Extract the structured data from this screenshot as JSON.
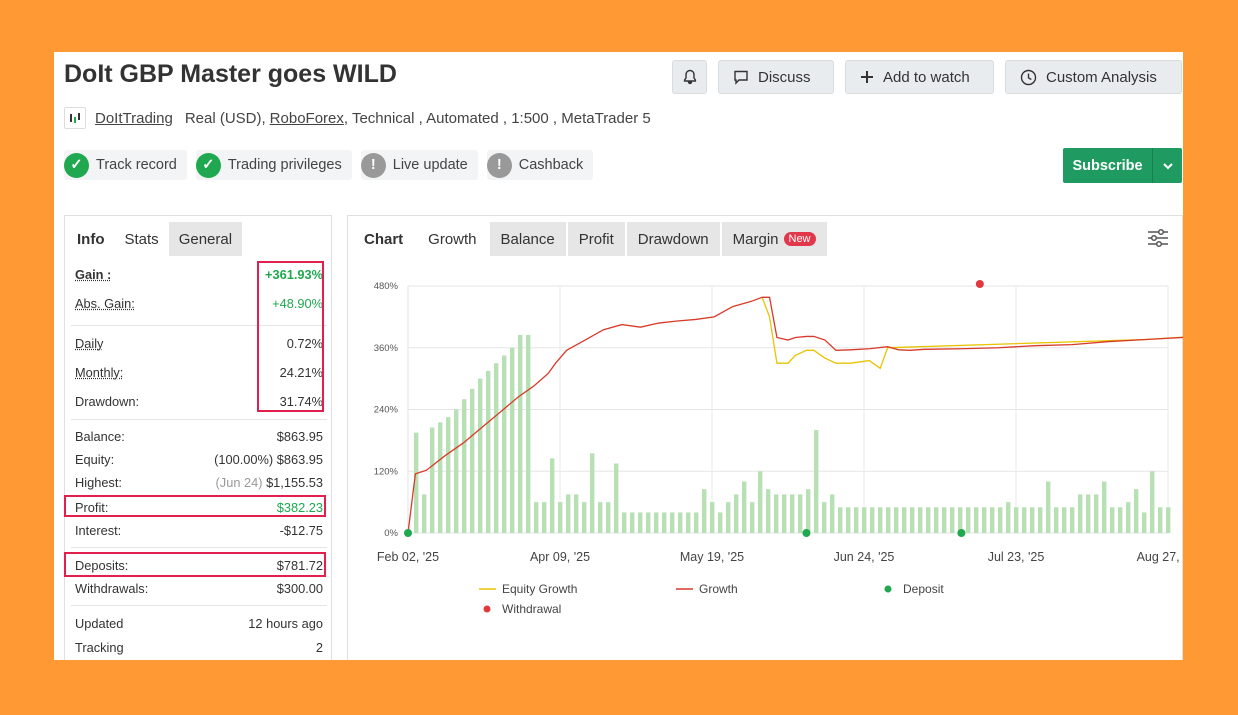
{
  "title": "DoIt GBP Master goes WILD",
  "top_buttons": {
    "discuss": "Discuss",
    "watch": "Add to watch",
    "custom": "Custom Analysis"
  },
  "meta": {
    "author": "DoItTrading",
    "account": "Real (USD),",
    "broker": "RoboForex",
    "rest": ", Technical , Automated , 1:500 , MetaTrader 5"
  },
  "badges": [
    {
      "label": "Track record",
      "status": "ok"
    },
    {
      "label": "Trading privileges",
      "status": "ok"
    },
    {
      "label": "Live update",
      "status": "no"
    },
    {
      "label": "Cashback",
      "status": "no"
    }
  ],
  "subscribe": "Subscribe",
  "left_tabs": {
    "info": "Info",
    "stats": "Stats",
    "general": "General"
  },
  "stats": {
    "gain": {
      "k": "Gain :",
      "v": "+361.93%"
    },
    "abs_gain": {
      "k": "Abs. Gain:",
      "v": "+48.90%"
    },
    "daily": {
      "k": "Daily",
      "v": "0.72%"
    },
    "monthly": {
      "k": "Monthly:",
      "v": "24.21%"
    },
    "drawdown": {
      "k": "Drawdown:",
      "v": "31.74%"
    },
    "balance": {
      "k": "Balance:",
      "v": "$863.95"
    },
    "equity": {
      "k": "Equity:",
      "v": "(100.00%) $863.95"
    },
    "highest": {
      "k": "Highest:",
      "muted": "(Jun 24)",
      "v": "$1,155.53"
    },
    "profit": {
      "k": "Profit:",
      "v": "$382.23"
    },
    "interest": {
      "k": "Interest:",
      "v": "-$12.75"
    },
    "deposits": {
      "k": "Deposits:",
      "v": "$781.72"
    },
    "withdrawals": {
      "k": "Withdrawals:",
      "v": "$300.00"
    },
    "updated": {
      "k": "Updated",
      "v": "12 hours ago"
    },
    "tracking": {
      "k": "Tracking",
      "v": "2"
    }
  },
  "right_tabs": {
    "chart": "Chart",
    "growth": "Growth",
    "balance": "Balance",
    "profit": "Profit",
    "drawdown": "Drawdown",
    "margin": "Margin",
    "new": "New"
  },
  "colors": {
    "green": "#1fa84f",
    "highlight": "#e2204e",
    "growth": "#d83a2a",
    "equity": "#e8c300",
    "bars": "#b7e0b4"
  },
  "chart_data": {
    "type": "line",
    "y_ticks": [
      "480%",
      "360%",
      "240%",
      "120%",
      "0%"
    ],
    "ylim": [
      0,
      480
    ],
    "x_ticks": [
      "Feb 02, '25",
      "Apr 09, '25",
      "May 19, '25",
      "Jun 24, '25",
      "Jul 23, '25",
      "Aug 27, '25"
    ],
    "x_range": [
      0,
      206
    ],
    "legend": [
      "Equity Growth",
      "Growth",
      "Deposit",
      "Withdrawal"
    ],
    "series": [
      {
        "name": "Growth",
        "points": [
          [
            0,
            0
          ],
          [
            2,
            115
          ],
          [
            5,
            122
          ],
          [
            10,
            150
          ],
          [
            15,
            175
          ],
          [
            20,
            205
          ],
          [
            25,
            235
          ],
          [
            30,
            265
          ],
          [
            34,
            285
          ],
          [
            38,
            310
          ],
          [
            40,
            330
          ],
          [
            43,
            355
          ],
          [
            48,
            375
          ],
          [
            53,
            395
          ],
          [
            58,
            405
          ],
          [
            63,
            400
          ],
          [
            68,
            408
          ],
          [
            73,
            412
          ],
          [
            78,
            415
          ],
          [
            83,
            420
          ],
          [
            88,
            440
          ],
          [
            93,
            450
          ],
          [
            96,
            458
          ],
          [
            98,
            458
          ],
          [
            100,
            380
          ],
          [
            103,
            375
          ],
          [
            105,
            380
          ],
          [
            108,
            382
          ],
          [
            110,
            382
          ],
          [
            113,
            375
          ],
          [
            116,
            355
          ],
          [
            120,
            356
          ],
          [
            125,
            358
          ],
          [
            130,
            362
          ],
          [
            133,
            356
          ],
          [
            136,
            355
          ],
          [
            140,
            357
          ],
          [
            150,
            358
          ],
          [
            160,
            360
          ],
          [
            170,
            364
          ],
          [
            180,
            366
          ],
          [
            190,
            372
          ],
          [
            200,
            376
          ],
          [
            205,
            378
          ],
          [
            215,
            382
          ],
          [
            225,
            386
          ],
          [
            231,
            390
          ],
          [
            235,
            397
          ],
          [
            240,
            402
          ],
          [
            244,
            405
          ],
          [
            247,
            400
          ],
          [
            250,
            392
          ],
          [
            252,
            356
          ],
          [
            255,
            350
          ],
          [
            260,
            352
          ],
          [
            265,
            356
          ],
          [
            270,
            360
          ],
          [
            274,
            362
          ]
        ]
      },
      {
        "name": "Equity Growth",
        "points": [
          [
            96,
            458
          ],
          [
            98,
            420
          ],
          [
            100,
            330
          ],
          [
            103,
            330
          ],
          [
            105,
            345
          ],
          [
            108,
            355
          ],
          [
            110,
            355
          ],
          [
            113,
            340
          ],
          [
            116,
            330
          ],
          [
            120,
            330
          ],
          [
            125,
            335
          ],
          [
            128,
            320
          ],
          [
            130,
            360
          ],
          [
            200,
            376
          ],
          [
            230,
            390
          ],
          [
            233,
            370
          ],
          [
            236,
            365
          ],
          [
            240,
            360
          ],
          [
            243,
            350
          ],
          [
            246,
            360
          ],
          [
            250,
            356
          ],
          [
            255,
            350
          ],
          [
            258,
            340
          ],
          [
            262,
            355
          ],
          [
            267,
            356
          ],
          [
            272,
            360
          ],
          [
            274,
            362
          ]
        ]
      }
    ],
    "profit_bars": [
      195,
      75,
      205,
      215,
      225,
      240,
      260,
      280,
      300,
      315,
      330,
      345,
      360,
      385,
      385,
      60,
      60,
      145,
      60,
      75,
      75,
      60,
      155,
      60,
      60,
      135,
      40,
      40,
      40,
      40,
      40,
      40,
      40,
      40,
      40,
      40,
      85,
      60,
      40,
      60,
      75,
      100,
      60,
      120,
      85,
      75,
      75,
      75,
      75,
      85,
      200,
      60,
      75,
      50,
      50,
      50,
      50,
      50,
      50,
      50,
      50,
      50,
      50,
      50,
      50,
      50,
      50,
      50,
      50,
      50,
      50,
      50,
      50,
      50,
      60,
      50,
      50,
      50,
      50,
      100,
      50,
      50,
      50,
      75,
      75,
      75,
      100,
      50,
      50,
      60,
      85,
      40,
      120,
      50,
      50
    ],
    "deposits": [
      0,
      108,
      150
    ],
    "withdrawals": [
      155
    ]
  }
}
